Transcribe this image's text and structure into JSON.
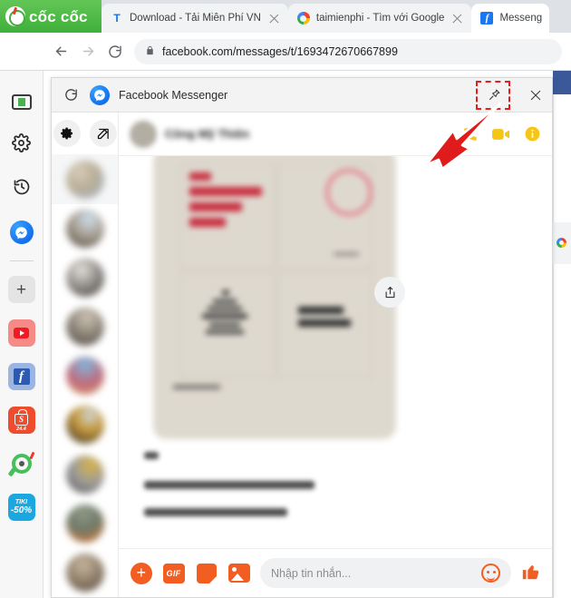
{
  "browser": {
    "brand": "cốc cốc",
    "brand_logo_icon": "coccoc-logo-icon",
    "tabs": [
      {
        "title": "Download - Tải Miễn Phí VN",
        "favicon": "taimienphi-t-icon",
        "active": false,
        "close_icon": "close-icon"
      },
      {
        "title": "taimienphi - Tìm với Google",
        "favicon": "google-g-icon",
        "active": false,
        "close_icon": "close-icon"
      },
      {
        "title": "Messeng",
        "favicon": "facebook-f-icon",
        "active": true,
        "close_icon": "close-icon"
      }
    ],
    "nav": {
      "back_icon": "back-arrow-icon",
      "forward_icon": "forward-arrow-icon",
      "reload_icon": "reload-icon",
      "lock_icon": "lock-icon",
      "url": "facebook.com/messages/t/1693472670667899"
    }
  },
  "sidebar": {
    "items": [
      {
        "name": "monitor-icon",
        "label": ""
      },
      {
        "name": "gear-icon",
        "label": ""
      },
      {
        "name": "history-icon",
        "label": ""
      },
      {
        "name": "messenger-icon",
        "label": ""
      },
      {
        "name": "add-icon",
        "label": "+"
      },
      {
        "name": "youtube-icon",
        "label": ""
      },
      {
        "name": "facebook-icon",
        "label": ""
      },
      {
        "name": "shopee-icon",
        "label": "S",
        "badge": "24.4"
      },
      {
        "name": "coccoc-icon",
        "label": ""
      },
      {
        "name": "tiki-icon",
        "label_top": "TIKI",
        "label_bottom": "-50%"
      }
    ]
  },
  "popup": {
    "reload_icon": "reload-icon",
    "app_icon": "messenger-icon",
    "title": "Facebook Messenger",
    "pin_icon": "pin-icon",
    "close_icon": "close-icon",
    "highlight_color": "#e81c1c",
    "pointer_color": "#e01b1b"
  },
  "messenger": {
    "toolbar": {
      "settings_icon": "gear-icon",
      "compose_icon": "compose-icon"
    },
    "conversations": [
      {
        "name": "conversation-avatar",
        "selected": true
      },
      {
        "name": "conversation-avatar",
        "selected": false
      },
      {
        "name": "conversation-avatar",
        "selected": false
      },
      {
        "name": "conversation-avatar",
        "selected": false
      },
      {
        "name": "conversation-avatar",
        "selected": false
      },
      {
        "name": "conversation-avatar",
        "selected": false
      },
      {
        "name": "conversation-avatar",
        "selected": false
      },
      {
        "name": "conversation-avatar",
        "selected": false
      },
      {
        "name": "conversation-avatar",
        "selected": false
      }
    ],
    "header": {
      "contact_name": "",
      "avatar": "contact-avatar",
      "call_icon": "phone-icon",
      "video_icon": "video-camera-icon",
      "info_icon": "info-icon",
      "icon_color": "#f5c518"
    },
    "thread": {
      "attachment_type": "image",
      "attachment_share_icon": "share-icon",
      "messages": [
        "",
        "",
        ""
      ]
    },
    "composer": {
      "add_icon": "plus-circle-icon",
      "gif_label": "GIF",
      "gif_icon": "gif-icon",
      "sticker_icon": "sticker-icon",
      "photo_icon": "photo-icon",
      "placeholder": "Nhập tin nhắn...",
      "input_value": "",
      "emoji_icon": "emoji-smiley-icon",
      "like_icon": "thumbs-up-icon",
      "accent_color": "#f25d22"
    }
  }
}
